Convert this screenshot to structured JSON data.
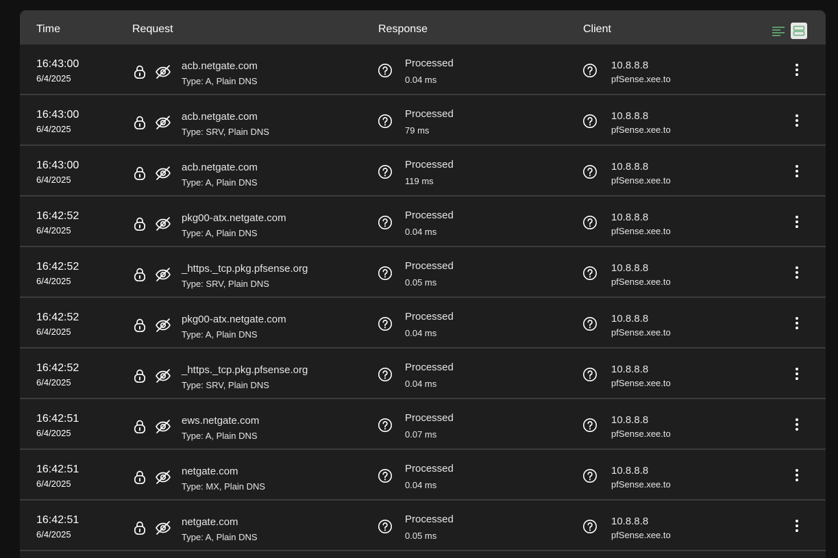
{
  "header": {
    "time": "Time",
    "request": "Request",
    "response": "Response",
    "client": "Client"
  },
  "icons": {
    "compact_view": "lines-icon",
    "default_view": "rows-icon",
    "lock": "lock-icon",
    "eye_off": "eye-off-icon",
    "response_help": "question-icon",
    "client_help": "question-icon",
    "menu": "kebab-menu-icon"
  },
  "colors": {
    "accent_green": "#67b279"
  },
  "rows": [
    {
      "time": "16:43:00",
      "date": "6/4/2025",
      "domain": "acb.netgate.com",
      "type": "Type: A, Plain DNS",
      "status": "Processed",
      "elapsed": "0.04 ms",
      "ip": "10.8.8.8",
      "host": "pfSense.xee.to"
    },
    {
      "time": "16:43:00",
      "date": "6/4/2025",
      "domain": "acb.netgate.com",
      "type": "Type: SRV, Plain DNS",
      "status": "Processed",
      "elapsed": "79 ms",
      "ip": "10.8.8.8",
      "host": "pfSense.xee.to"
    },
    {
      "time": "16:43:00",
      "date": "6/4/2025",
      "domain": "acb.netgate.com",
      "type": "Type: A, Plain DNS",
      "status": "Processed",
      "elapsed": "119 ms",
      "ip": "10.8.8.8",
      "host": "pfSense.xee.to"
    },
    {
      "time": "16:42:52",
      "date": "6/4/2025",
      "domain": "pkg00-atx.netgate.com",
      "type": "Type: A, Plain DNS",
      "status": "Processed",
      "elapsed": "0.04 ms",
      "ip": "10.8.8.8",
      "host": "pfSense.xee.to"
    },
    {
      "time": "16:42:52",
      "date": "6/4/2025",
      "domain": "_https._tcp.pkg.pfsense.org",
      "type": "Type: SRV, Plain DNS",
      "status": "Processed",
      "elapsed": "0.05 ms",
      "ip": "10.8.8.8",
      "host": "pfSense.xee.to"
    },
    {
      "time": "16:42:52",
      "date": "6/4/2025",
      "domain": "pkg00-atx.netgate.com",
      "type": "Type: A, Plain DNS",
      "status": "Processed",
      "elapsed": "0.04 ms",
      "ip": "10.8.8.8",
      "host": "pfSense.xee.to"
    },
    {
      "time": "16:42:52",
      "date": "6/4/2025",
      "domain": "_https._tcp.pkg.pfsense.org",
      "type": "Type: SRV, Plain DNS",
      "status": "Processed",
      "elapsed": "0.04 ms",
      "ip": "10.8.8.8",
      "host": "pfSense.xee.to"
    },
    {
      "time": "16:42:51",
      "date": "6/4/2025",
      "domain": "ews.netgate.com",
      "type": "Type: A, Plain DNS",
      "status": "Processed",
      "elapsed": "0.07 ms",
      "ip": "10.8.8.8",
      "host": "pfSense.xee.to"
    },
    {
      "time": "16:42:51",
      "date": "6/4/2025",
      "domain": "netgate.com",
      "type": "Type: MX, Plain DNS",
      "status": "Processed",
      "elapsed": "0.04 ms",
      "ip": "10.8.8.8",
      "host": "pfSense.xee.to"
    },
    {
      "time": "16:42:51",
      "date": "6/4/2025",
      "domain": "netgate.com",
      "type": "Type: A, Plain DNS",
      "status": "Processed",
      "elapsed": "0.05 ms",
      "ip": "10.8.8.8",
      "host": "pfSense.xee.to"
    }
  ]
}
